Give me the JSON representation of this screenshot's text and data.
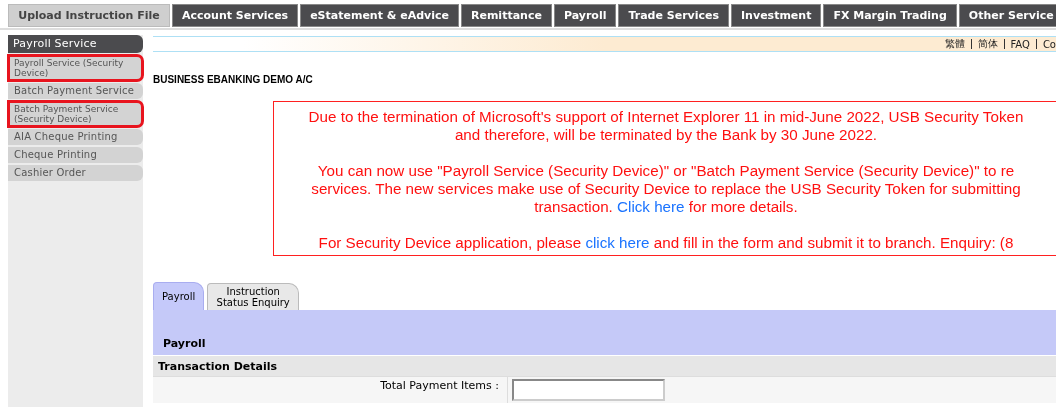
{
  "nav_tabs": [
    {
      "label": "Upload Instruction File",
      "selected": true
    },
    {
      "label": "Account Services",
      "selected": false
    },
    {
      "label": "eStatement & eAdvice",
      "selected": false
    },
    {
      "label": "Remittance",
      "selected": false
    },
    {
      "label": "Payroll",
      "selected": false
    },
    {
      "label": "Trade Services",
      "selected": false
    },
    {
      "label": "Investment",
      "selected": false
    },
    {
      "label": "FX Margin Trading",
      "selected": false
    },
    {
      "label": "Other Service",
      "selected": false
    }
  ],
  "header_links": [
    "繁體",
    "简体",
    "FAQ",
    "Co"
  ],
  "sidebar": {
    "items": [
      {
        "label": "Payroll Service",
        "kind": "header",
        "highlighted": false
      },
      {
        "label": "Payroll Service (Security Device)",
        "kind": "item",
        "highlighted": true
      },
      {
        "label": "Batch Payment Service",
        "kind": "item",
        "highlighted": false
      },
      {
        "label": "Batch Payment Service (Security Device)",
        "kind": "item",
        "highlighted": true
      },
      {
        "label": "AIA Cheque Printing",
        "kind": "item",
        "highlighted": false
      },
      {
        "label": "Cheque Printing",
        "kind": "item",
        "highlighted": false
      },
      {
        "label": "Cashier Order",
        "kind": "item",
        "highlighted": false
      }
    ]
  },
  "account_name": "BUSINESS EBANKING DEMO A/C",
  "notice": {
    "paragraphs": [
      [
        "Due to the termination of Microsoft's support of Internet Explorer 11 in mid-June 2022, USB Security Token",
        "and therefore, will be terminated by the Bank by 30 June 2022."
      ],
      [
        "You can now use \"Payroll Service (Security Device)\" or \"Batch Payment Service (Security Device)\" to re",
        "services. The new services make use of Security Device to replace the USB Security Token for submitting",
        [
          {
            "text": "transaction. ",
            "link": false
          },
          {
            "text": "Click here",
            "link": true
          },
          {
            "text": " for more details.",
            "link": false
          }
        ]
      ],
      [
        [
          {
            "text": "For Security Device application, please ",
            "link": false
          },
          {
            "text": "click here",
            "link": true
          },
          {
            "text": " and fill in the form and submit it to branch. Enquiry: (8",
            "link": false
          }
        ]
      ]
    ]
  },
  "sub_tabs": [
    {
      "label": "Payroll",
      "selected": true
    },
    {
      "label": "Instruction Status Enquiry",
      "selected": false
    }
  ],
  "panel_title": "Payroll",
  "section_title": "Transaction Details",
  "fields": [
    {
      "label": "Total Payment Items :"
    }
  ]
}
